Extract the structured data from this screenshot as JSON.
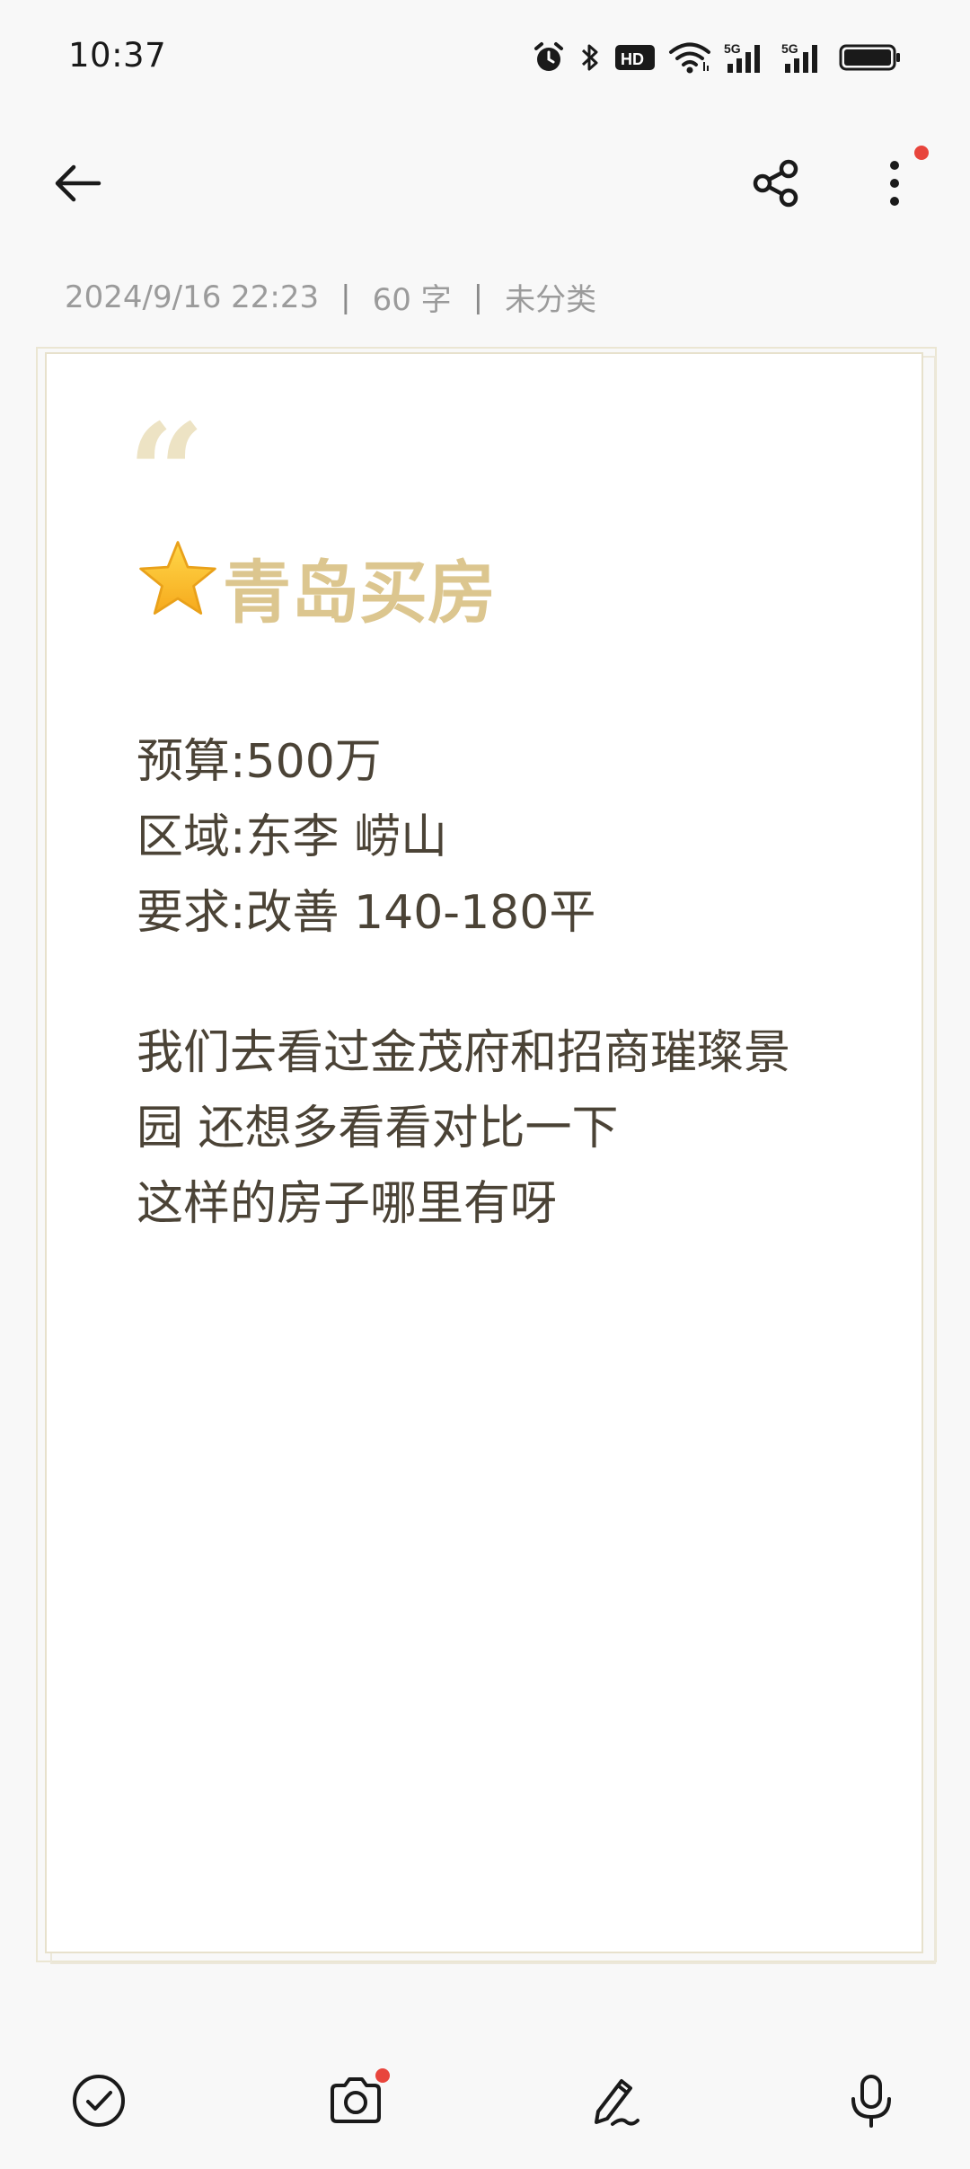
{
  "status_bar": {
    "time": "10:37",
    "icons": [
      "alarm-icon",
      "bluetooth-icon",
      "hd-icon",
      "wifi-icon",
      "signal-5g-icon",
      "signal-5g-icon",
      "battery-icon"
    ],
    "hd_label": "HD",
    "signal_label": "5G"
  },
  "app_bar": {
    "back_icon": "arrow-left-icon",
    "share_icon": "share-icon",
    "more_icon": "more-vertical-icon",
    "notification_dot_color": "#e8453c"
  },
  "meta": {
    "datetime": "2024/9/16 22:23",
    "separator": "|",
    "word_count": "60 字",
    "category": "未分类"
  },
  "note": {
    "quote_mark": "“",
    "title_emoji": "⭐",
    "title": "青岛买房",
    "title_color": "#dcc68f",
    "paragraphs": [
      [
        "预算:500万",
        "区域:东李 崂山",
        "要求:改善 140-180平"
      ],
      [
        "我们去看过金茂府和招商璀璨景",
        "园 还想多看看对比一下",
        "这样的房子哪里有呀"
      ]
    ]
  },
  "toolbar": {
    "items": [
      {
        "icon": "checklist-icon"
      },
      {
        "icon": "camera-icon",
        "badge": true
      },
      {
        "icon": "pen-icon"
      },
      {
        "icon": "microphone-icon"
      }
    ]
  }
}
